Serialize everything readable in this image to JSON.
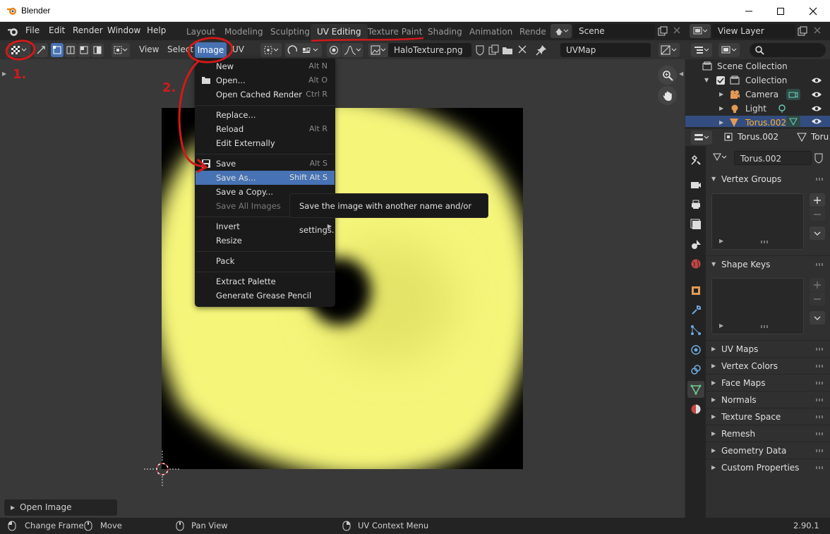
{
  "window": {
    "title": "Blender"
  },
  "menu_bar": {
    "items": [
      "File",
      "Edit",
      "Render",
      "Window",
      "Help"
    ]
  },
  "workspace_tabs": [
    "Layout",
    "Modeling",
    "Sculpting",
    "UV Editing",
    "Texture Paint",
    "Shading",
    "Animation",
    "Render"
  ],
  "active_workspace": "UV Editing",
  "scene": {
    "name": "Scene"
  },
  "view_layer": {
    "name": "View Layer"
  },
  "uv_header": {
    "view": "View",
    "select": "Select",
    "image": "Image",
    "uv": "UV",
    "image_name": "HaloTexture.png",
    "uv_map": "UVMap"
  },
  "image_menu": {
    "items": [
      {
        "label": "New",
        "shortcut": "Alt N",
        "icon": ""
      },
      {
        "label": "Open...",
        "shortcut": "Alt O",
        "icon": "folder-icon"
      },
      {
        "label": "Open Cached Render",
        "shortcut": "Ctrl R",
        "icon": ""
      },
      {
        "label": "Replace...",
        "shortcut": "",
        "icon": ""
      },
      {
        "label": "Reload",
        "shortcut": "Alt R",
        "icon": ""
      },
      {
        "label": "Edit Externally",
        "shortcut": "",
        "icon": ""
      },
      {
        "label": "Save",
        "shortcut": "Alt S",
        "icon": "save-icon"
      },
      {
        "label": "Save As...",
        "shortcut": "Shift Alt S",
        "icon": ""
      },
      {
        "label": "Save a Copy...",
        "shortcut": "",
        "icon": ""
      },
      {
        "label": "Save All Images",
        "shortcut": "",
        "icon": ""
      },
      {
        "label": "Invert",
        "shortcut": "",
        "icon": ""
      },
      {
        "label": "Resize",
        "shortcut": "",
        "icon": ""
      },
      {
        "label": "Pack",
        "shortcut": "",
        "icon": ""
      },
      {
        "label": "Extract Palette",
        "shortcut": "",
        "icon": ""
      },
      {
        "label": "Generate Grease Pencil",
        "shortcut": "",
        "icon": ""
      }
    ],
    "highlighted": "Save As...",
    "disabled": "Save All Images",
    "submenu": "Invert"
  },
  "tooltip": {
    "text": "Save the image with another name and/or settings."
  },
  "annotations": {
    "step1": "1.",
    "step2": "2."
  },
  "outliner": {
    "title": "Scene Collection",
    "items": [
      {
        "label": "Collection",
        "icon": "collection-icon"
      },
      {
        "label": "Camera",
        "icon": "camera-icon"
      },
      {
        "label": "Light",
        "icon": "light-icon"
      },
      {
        "label": "Torus.002",
        "icon": "mesh-icon"
      }
    ]
  },
  "properties": {
    "object_name": "Torus.002",
    "data_tab": "Toru",
    "mesh_name": "Torus.002",
    "open_panels": [
      "Vertex Groups",
      "Shape Keys"
    ],
    "collapsed_panels": [
      "UV Maps",
      "Vertex Colors",
      "Face Maps",
      "Normals",
      "Texture Space",
      "Remesh",
      "Geometry Data",
      "Custom Properties"
    ]
  },
  "redo_panel": {
    "label": "Open Image"
  },
  "status_bar": {
    "items": [
      "Change Frame",
      "Move",
      "Pan View",
      "UV Context Menu"
    ],
    "version": "2.90.1"
  },
  "colors": {
    "accent": "#4772b3",
    "annotation": "#d11a1a",
    "texture_glow": "#f5f57a"
  }
}
